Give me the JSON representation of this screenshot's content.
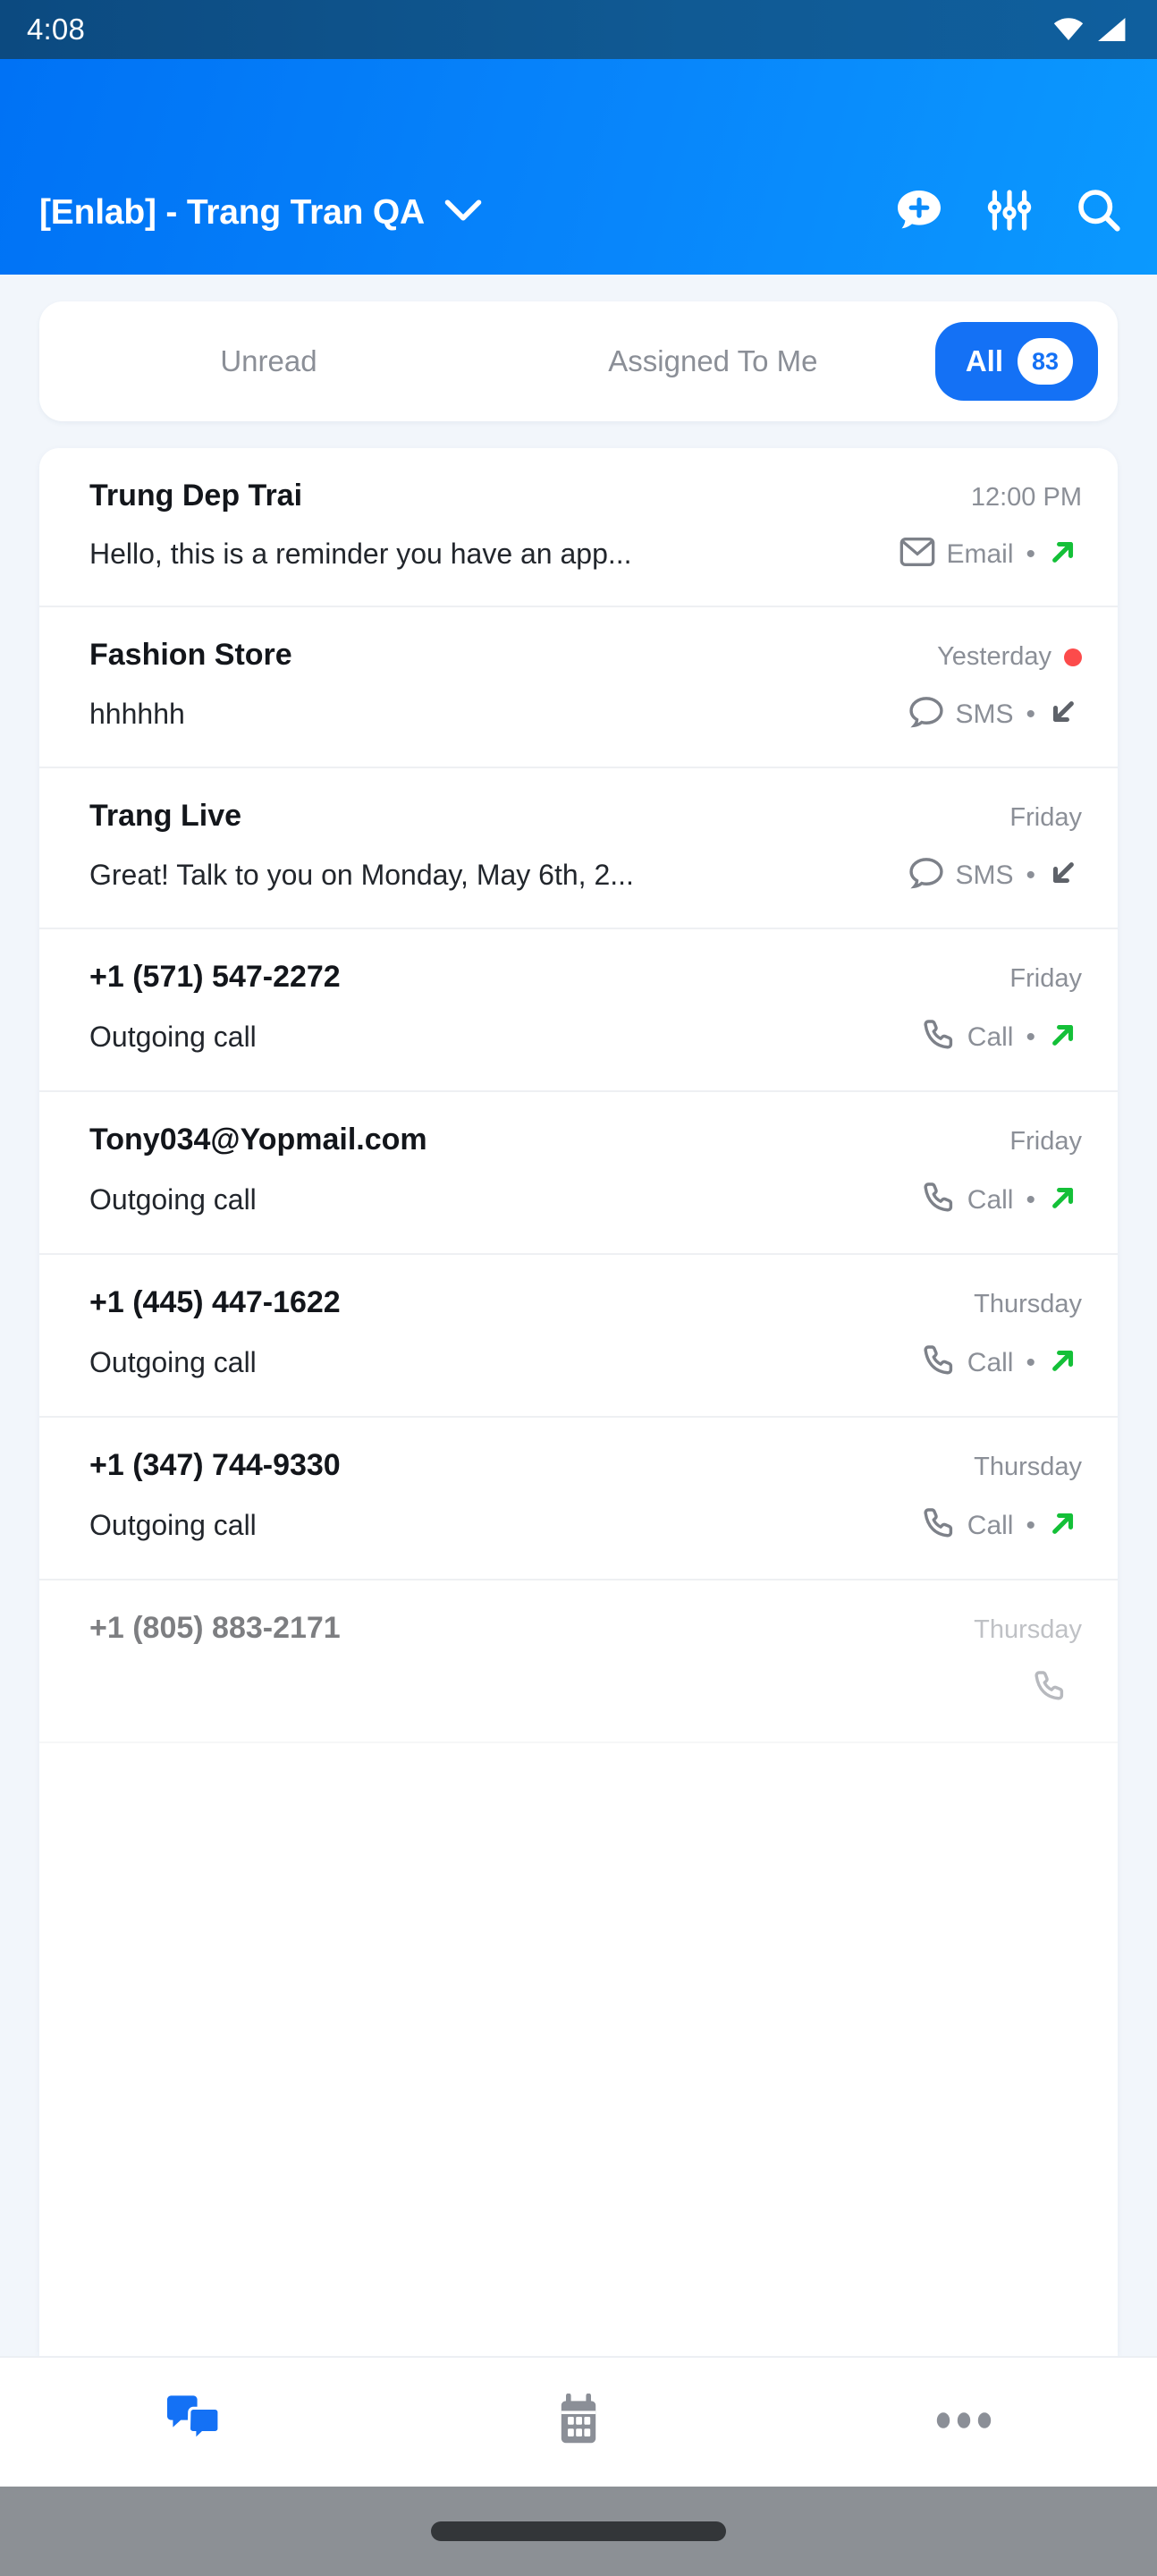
{
  "status_bar": {
    "time": "4:08",
    "icons": [
      "wifi-icon",
      "cellular-signal-icon"
    ]
  },
  "header": {
    "account_title": "[Enlab] - Trang Tran QA",
    "dropdown_icon": "chevron-down-icon",
    "actions": [
      {
        "name": "new-message-icon",
        "label": "New message"
      },
      {
        "name": "filter-icon",
        "label": "Filter"
      },
      {
        "name": "search-icon",
        "label": "Search"
      }
    ]
  },
  "filter_tabs": {
    "items": [
      {
        "label": "Unread",
        "active": false
      },
      {
        "label": "Assigned To Me",
        "active": false
      }
    ],
    "active_tab": {
      "label": "All",
      "count": "83"
    }
  },
  "conversations": [
    {
      "name": "Trung Dep Trai",
      "time": "12:00 PM",
      "preview": "Hello, this is a reminder you have an app...",
      "channel": "Email",
      "channel_icon": "email-icon",
      "direction": "outgoing",
      "direction_icon": "arrow-up-right-icon",
      "unread": false
    },
    {
      "name": "Fashion Store",
      "time": "Yesterday",
      "preview": "hhhhhh",
      "channel": "SMS",
      "channel_icon": "sms-bubble-icon",
      "direction": "incoming",
      "direction_icon": "arrow-down-left-icon",
      "unread": true
    },
    {
      "name": "Trang Live",
      "time": "Friday",
      "preview": "Great! Talk to you on Monday, May 6th, 2...",
      "channel": "SMS",
      "channel_icon": "sms-bubble-icon",
      "direction": "incoming",
      "direction_icon": "arrow-down-left-icon",
      "unread": false
    },
    {
      "name": "+1 (571) 547-2272",
      "time": "Friday",
      "preview": "Outgoing call",
      "channel": "Call",
      "channel_icon": "phone-icon",
      "direction": "outgoing",
      "direction_icon": "arrow-up-right-icon",
      "unread": false
    },
    {
      "name": "Tony034@Yopmail.com",
      "time": "Friday",
      "preview": "Outgoing call",
      "channel": "Call",
      "channel_icon": "phone-icon",
      "direction": "outgoing",
      "direction_icon": "arrow-up-right-icon",
      "unread": false
    },
    {
      "name": "+1 (445) 447-1622",
      "time": "Thursday",
      "preview": "Outgoing call",
      "channel": "Call",
      "channel_icon": "phone-icon",
      "direction": "outgoing",
      "direction_icon": "arrow-up-right-icon",
      "unread": false
    },
    {
      "name": "+1 (347) 744-9330",
      "time": "Thursday",
      "preview": "Outgoing call",
      "channel": "Call",
      "channel_icon": "phone-icon",
      "direction": "outgoing",
      "direction_icon": "arrow-up-right-icon",
      "unread": false
    },
    {
      "name": "+1 (805) 883-2171",
      "time": "Thursday",
      "preview": "",
      "channel": "",
      "channel_icon": "phone-icon",
      "direction": "outgoing",
      "direction_icon": "arrow-up-right-icon",
      "unread": false,
      "partial": true
    }
  ],
  "bottom_nav": [
    {
      "name": "nav-inbox",
      "icon": "chat-bubbles-icon",
      "active": true
    },
    {
      "name": "nav-calendar",
      "icon": "calendar-icon",
      "active": false
    },
    {
      "name": "nav-more",
      "icon": "more-dots-icon",
      "active": false
    }
  ],
  "colors": {
    "brand_blue": "#0886fb",
    "active_pill": "#1471f5",
    "status_bar": "#0f5a93",
    "unread_dot": "#fc4b4b",
    "outgoing_arrow": "#14c038",
    "incoming_arrow": "#6b6f76",
    "page_bg": "#f2f6fb"
  }
}
